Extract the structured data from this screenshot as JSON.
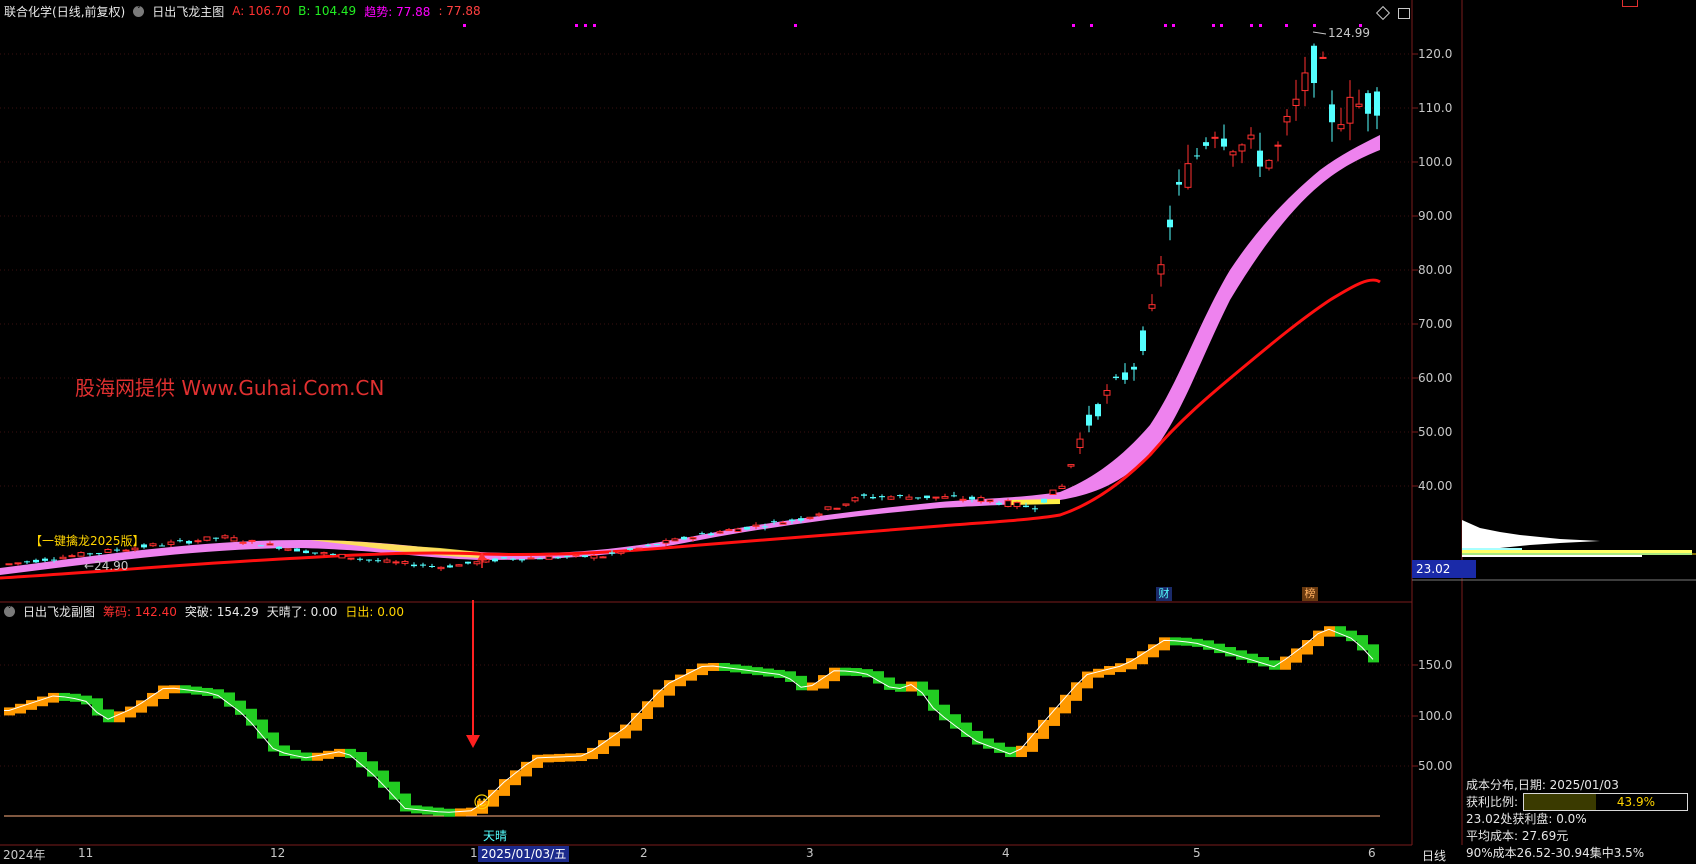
{
  "header": {
    "stock_name": "联合化学",
    "period": "(日线,前复权)",
    "indicator_name": "日出飞龙主图",
    "a_label": "A:",
    "a_value": "106.70",
    "b_label": "B:",
    "b_value": "104.49",
    "trend_label": "趋势:",
    "trend_value": "77.88",
    "trend_value2": "77.88"
  },
  "sub_header": {
    "indicator_name": "日出飞龙副图",
    "chip_label": "筹码:",
    "chip_value": "142.40",
    "breakout_label": "突破:",
    "breakout_value": "154.29",
    "sunny_label": "天晴了:",
    "sunny_value": "0.00",
    "sunrise_label": "日出:",
    "sunrise_value": "0.00"
  },
  "main_chart": {
    "watermark": "股海网提供 Www.Guhai.Com.CN",
    "tag_yijian": "【一键擒龙2025版】",
    "low_annotation": "←24.90",
    "high_annotation": "124.99",
    "y_ticks": [
      "120.0",
      "110.0",
      "100.0",
      "90.00",
      "80.00",
      "70.00",
      "60.00",
      "50.00",
      "40.00"
    ],
    "current_price_tag": "23.02",
    "tag_cai": "财",
    "tag_bang": "榜"
  },
  "sub_chart": {
    "y_ticks": [
      "150.0",
      "100.0",
      "50.00"
    ],
    "sunny_label": "天晴",
    "smiley": "☺"
  },
  "x_axis": {
    "ticks": [
      "2024年",
      "11",
      "12",
      "1",
      "2",
      "3",
      "4",
      "5",
      "6"
    ],
    "cursor_date": "2025/01/03/五",
    "period_button": "日线"
  },
  "cost_panel": {
    "line1": "成本分布,日期: 2025/01/03",
    "profit_ratio_label": "获利比例:",
    "profit_ratio_value": "43.9%",
    "profit_ratio_fraction": 0.439,
    "line3": "23.02处获利盘: 0.0%",
    "line4": "平均成本: 27.69元",
    "line5": "90%成本26.52-30.94集中3.5%"
  },
  "colors": {
    "up": "#ff3030",
    "down": "#54ffff",
    "ribbon": "#ee82ee",
    "ma_red": "#ff1010",
    "orange": "#ff9900",
    "green": "#22cc22",
    "yellow": "#ffd400",
    "magenta": "#ff00ff"
  }
}
